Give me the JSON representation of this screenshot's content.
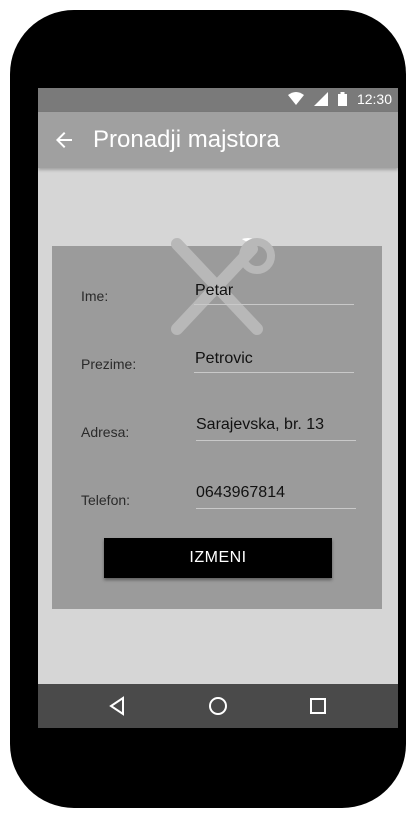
{
  "status": {
    "time": "12:30"
  },
  "appbar": {
    "title": "Pronadji majstora"
  },
  "form": {
    "fields": [
      {
        "label": "Ime:",
        "value": "Petar"
      },
      {
        "label": "Prezime:",
        "value": "Petrovic"
      },
      {
        "label": "Adresa:",
        "value": "Sarajevska, br. 13"
      },
      {
        "label": "Telefon:",
        "value": "0643967814"
      }
    ],
    "button_label": "IZMENI"
  },
  "icons": [
    "wifi-icon",
    "signal-icon",
    "battery-icon",
    "back-arrow-icon",
    "tools-icon",
    "nav-back-icon",
    "nav-home-icon",
    "nav-recents-icon"
  ]
}
